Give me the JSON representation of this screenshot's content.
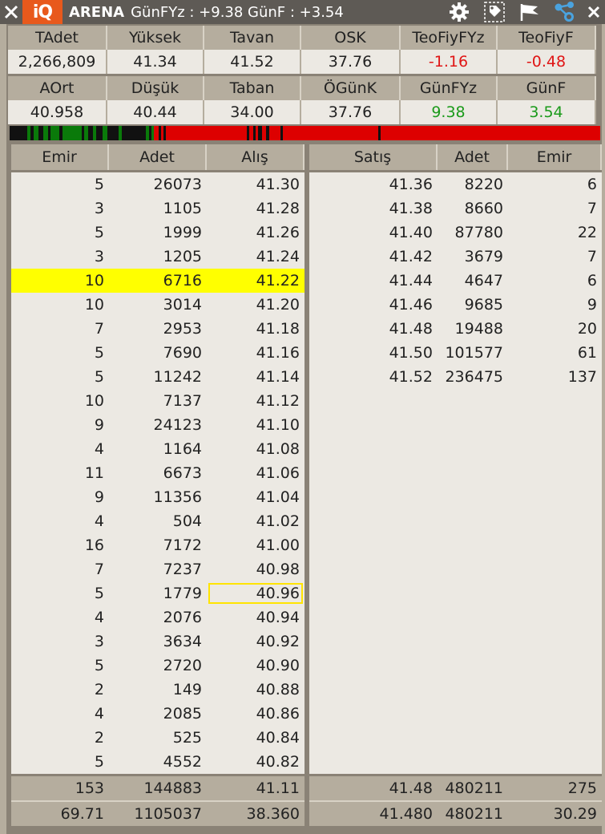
{
  "window": {
    "logo_text": "iQ",
    "symbol": "ARENA",
    "info": "GünFYz : +9.38  GünF : +3.54",
    "icons": [
      "close-icon",
      "gear-icon",
      "tag-icon",
      "flag-icon",
      "share-icon",
      "close-icon"
    ]
  },
  "stats": {
    "row1_headers": [
      "TAdet",
      "Yüksek",
      "Tavan",
      "OSK",
      "TeoFiyFYz",
      "TeoFiyF"
    ],
    "row1_values": [
      "2,266,809",
      "41.34",
      "41.52",
      "37.76",
      "-1.16",
      "-0.48"
    ],
    "row2_headers": [
      "AOrt",
      "Düşük",
      "Taban",
      "ÖGünK",
      "GünFYz",
      "GünF"
    ],
    "row2_values": [
      "40.958",
      "40.44",
      "34.00",
      "37.76",
      "9.38",
      "3.54"
    ]
  },
  "colors": {
    "negative": "#e01515",
    "positive": "#1a9a1a",
    "highlight": "#ffff00",
    "bid_depth": "#0a7a0a",
    "ask_depth": "#dd0000"
  },
  "bids": {
    "headers": [
      "Emir",
      "Adet",
      "Alış"
    ],
    "rows": [
      [
        "5",
        "26073",
        "41.30"
      ],
      [
        "3",
        "1105",
        "41.28"
      ],
      [
        "5",
        "1999",
        "41.26"
      ],
      [
        "3",
        "1205",
        "41.24"
      ],
      [
        "10",
        "6716",
        "41.22"
      ],
      [
        "10",
        "3014",
        "41.20"
      ],
      [
        "7",
        "2953",
        "41.18"
      ],
      [
        "5",
        "7690",
        "41.16"
      ],
      [
        "5",
        "11242",
        "41.14"
      ],
      [
        "10",
        "7137",
        "41.12"
      ],
      [
        "9",
        "24123",
        "41.10"
      ],
      [
        "4",
        "1164",
        "41.08"
      ],
      [
        "11",
        "6673",
        "41.06"
      ],
      [
        "9",
        "11356",
        "41.04"
      ],
      [
        "4",
        "504",
        "41.02"
      ],
      [
        "16",
        "7172",
        "41.00"
      ],
      [
        "7",
        "7237",
        "40.98"
      ],
      [
        "5",
        "1779",
        "40.96"
      ],
      [
        "4",
        "2076",
        "40.94"
      ],
      [
        "3",
        "3634",
        "40.92"
      ],
      [
        "5",
        "2720",
        "40.90"
      ],
      [
        "2",
        "149",
        "40.88"
      ],
      [
        "4",
        "2085",
        "40.86"
      ],
      [
        "2",
        "525",
        "40.84"
      ],
      [
        "5",
        "4552",
        "40.82"
      ]
    ],
    "totals": [
      [
        "153",
        "144883",
        "41.11"
      ],
      [
        "69.71",
        "1105037",
        "38.360"
      ]
    ]
  },
  "asks": {
    "headers": [
      "Satış",
      "Adet",
      "Emir"
    ],
    "rows": [
      [
        "41.36",
        "8220",
        "6"
      ],
      [
        "41.38",
        "8660",
        "7"
      ],
      [
        "41.40",
        "87780",
        "22"
      ],
      [
        "41.42",
        "3679",
        "7"
      ],
      [
        "41.44",
        "4647",
        "6"
      ],
      [
        "41.46",
        "9685",
        "9"
      ],
      [
        "41.48",
        "19488",
        "20"
      ],
      [
        "41.50",
        "101577",
        "61"
      ],
      [
        "41.52",
        "236475",
        "137"
      ]
    ],
    "totals": [
      [
        "41.48",
        "480211",
        "275"
      ],
      [
        "41.480",
        "480211",
        "30.29"
      ]
    ]
  }
}
